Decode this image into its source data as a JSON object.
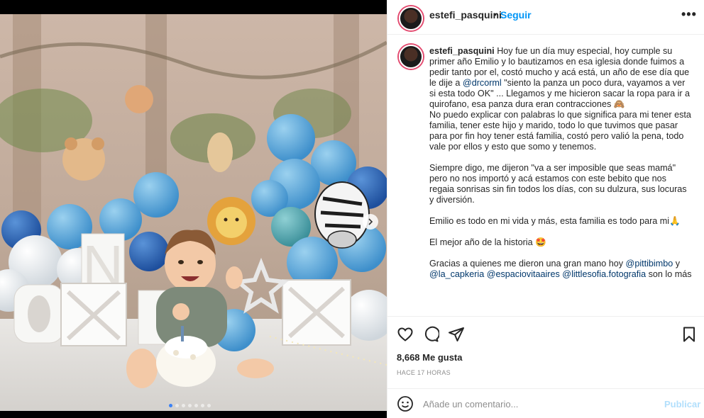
{
  "post": {
    "username": "estefi_pasquini",
    "follow_dot": "•",
    "follow_label": "Seguir",
    "more_label": "•••",
    "likes": "8,668 Me gusta",
    "time_ago": "HACE 17 HORAS",
    "carousel": {
      "total_slides": 7,
      "active_slide": 1
    }
  },
  "caption": {
    "username": "estefi_pasquini",
    "p1_a": "Hoy fue un día muy especial, hoy cumple su primer año Emilio y lo bautizamos en esa iglesia donde fuimos a pedir tanto por el, costó mucho y acá está, un año de ese día que le dije a",
    "p1_mention": "@drcorml",
    "p1_b": "\"siento la panza un poco dura, vayamos a ver si esta todo OK\" ... Llegamos y me hicieron sacar la ropa para ir a quirofano, esa panza dura eran contracciones",
    "p1_emoji": "🙈",
    "p1_c": "No puedo explicar con palabras lo que significa para mi tener esta familia, tener este hijo y marido, todo lo que tuvimos que pasar para por fin hoy tener está familia, costó pero valió la pena, todo vale por ellos y esto que somo y tenemos.",
    "p2": "Siempre digo, me dijeron \"va a ser imposible que seas mamá\" pero no nos importó y acá estamos con este bebito que nos regaia sonrisas sin fin todos los días, con su dulzura, sus locuras y diversión.",
    "p3": "Emilio es todo en mi vida y más, esta familia es todo para mi",
    "p3_emoji": "🙏",
    "p4": "El mejor año de la historia",
    "p4_emoji": "🤩",
    "p5_a": "Gracias a quienes me dieron una gran mano hoy",
    "p5_m1": "@pittibimbo",
    "p5_y": "y",
    "p5_m2": "@la_capkeria",
    "p5_m3": "@espaciovitaaires",
    "p5_m4": "@littlesofia.fotografia",
    "p5_b": "son lo más"
  },
  "comment": {
    "placeholder": "Añade un comentario...",
    "publish_label": "Publicar"
  },
  "icons": {
    "like": "heart-icon",
    "comment": "comment-bubble-icon",
    "share": "paper-plane-icon",
    "save": "bookmark-icon",
    "emoji": "smiley-icon",
    "next": "chevron-right-icon"
  },
  "colors": {
    "follow": "#0095f6",
    "mention": "#00376b",
    "publish_disabled": "#b2dffc",
    "muted": "#8e8e8e",
    "text": "#262626",
    "carousel_active_dot": "#3b82f6"
  }
}
